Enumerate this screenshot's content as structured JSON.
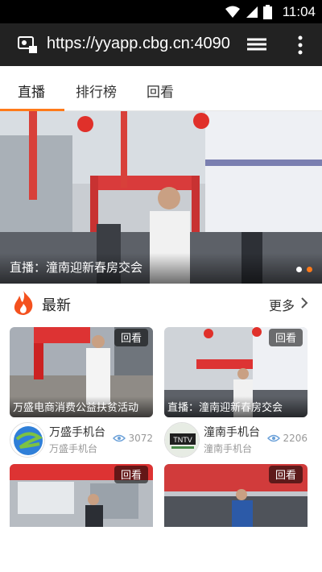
{
  "status": {
    "time": "11:04"
  },
  "browser": {
    "url": "https://yyapp.cbg.cn:4090"
  },
  "tabs": [
    "直播",
    "排行榜",
    "回看"
  ],
  "hero": {
    "caption": "直播：潼南迎新春房交会"
  },
  "section": {
    "title": "最新",
    "more": "更多"
  },
  "cards": [
    {
      "badge": "回看",
      "caption": "万盛电商消费公益扶贫活动",
      "channel": "万盛手机台",
      "sub": "万盛手机台",
      "views": "3072"
    },
    {
      "badge": "回看",
      "caption": "直播：潼南迎新春房交会",
      "channel": "潼南手机台",
      "sub": "潼南手机台",
      "views": "2206"
    },
    {
      "badge": "回看",
      "caption": "",
      "channel": "",
      "sub": "",
      "views": ""
    },
    {
      "badge": "回看",
      "caption": "",
      "channel": "",
      "sub": "",
      "views": ""
    }
  ],
  "colors": {
    "accent": "#ff7a1a",
    "fire": "#f4511e"
  }
}
